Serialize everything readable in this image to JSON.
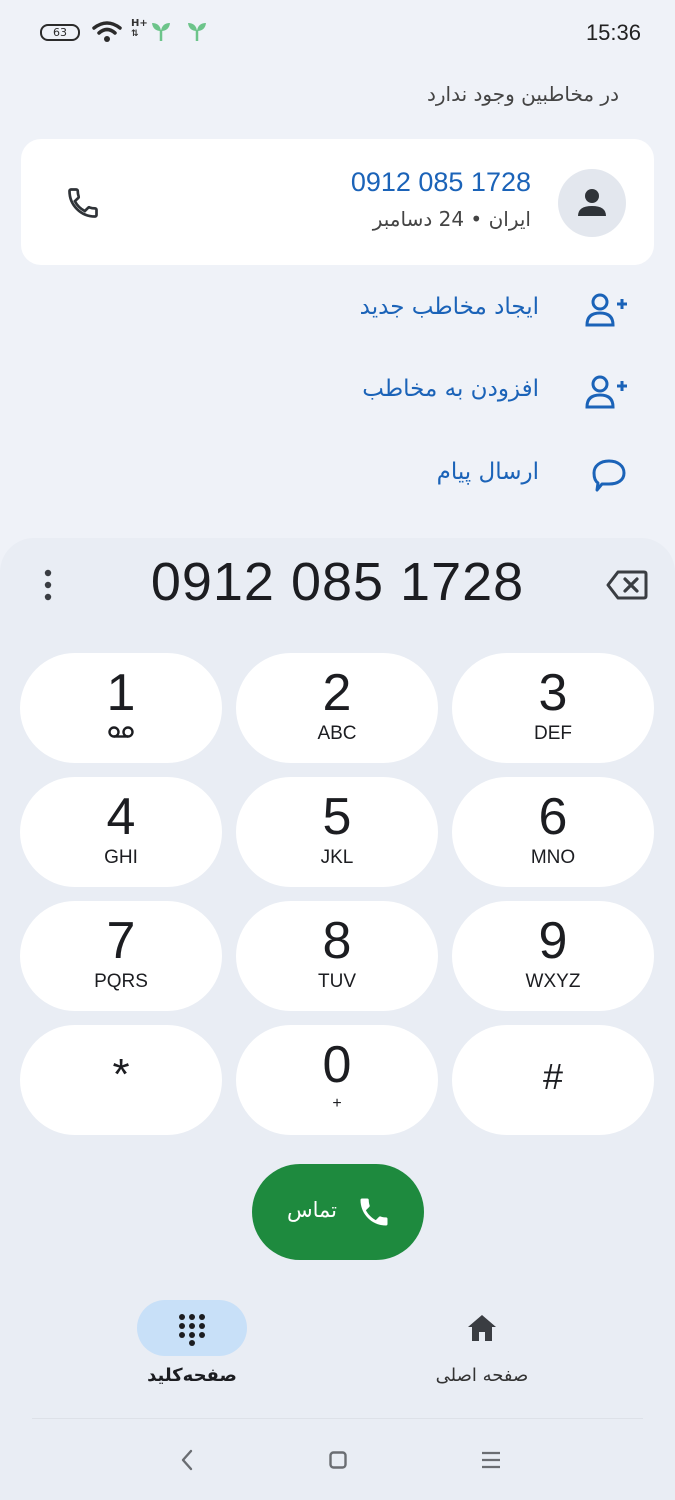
{
  "status_bar": {
    "battery": "63",
    "network": "H+",
    "time": "15:36"
  },
  "header": {
    "not_in_contacts": "در مخاطبین وجود ندارد"
  },
  "number_card": {
    "number": "0912 085 1728",
    "subtitle": "ایران • 24 دسامبر"
  },
  "actions": [
    {
      "label": "ایجاد مخاطب جدید",
      "icon": "person-add-icon"
    },
    {
      "label": "افزودن به مخاطب",
      "icon": "person-add-icon"
    },
    {
      "label": "ارسال پیام",
      "icon": "message-icon"
    }
  ],
  "dialer": {
    "display": "0912 085 1728",
    "keys": [
      {
        "digit": "1",
        "letters": ""
      },
      {
        "digit": "2",
        "letters": "ABC"
      },
      {
        "digit": "3",
        "letters": "DEF"
      },
      {
        "digit": "4",
        "letters": "GHI"
      },
      {
        "digit": "5",
        "letters": "JKL"
      },
      {
        "digit": "6",
        "letters": "MNO"
      },
      {
        "digit": "7",
        "letters": "PQRS"
      },
      {
        "digit": "8",
        "letters": "TUV"
      },
      {
        "digit": "9",
        "letters": "WXYZ"
      },
      {
        "digit": "*",
        "letters": ""
      },
      {
        "digit": "0",
        "letters": "+"
      },
      {
        "digit": "#",
        "letters": ""
      }
    ],
    "call_label": "تماس"
  },
  "bottom_nav": {
    "keypad_label": "صفحه‌کلید",
    "home_label": "صفحه اصلی"
  },
  "colors": {
    "accent_blue": "#1b63b8",
    "call_green": "#1e8a3e",
    "active_pill": "#c8e0f8"
  }
}
